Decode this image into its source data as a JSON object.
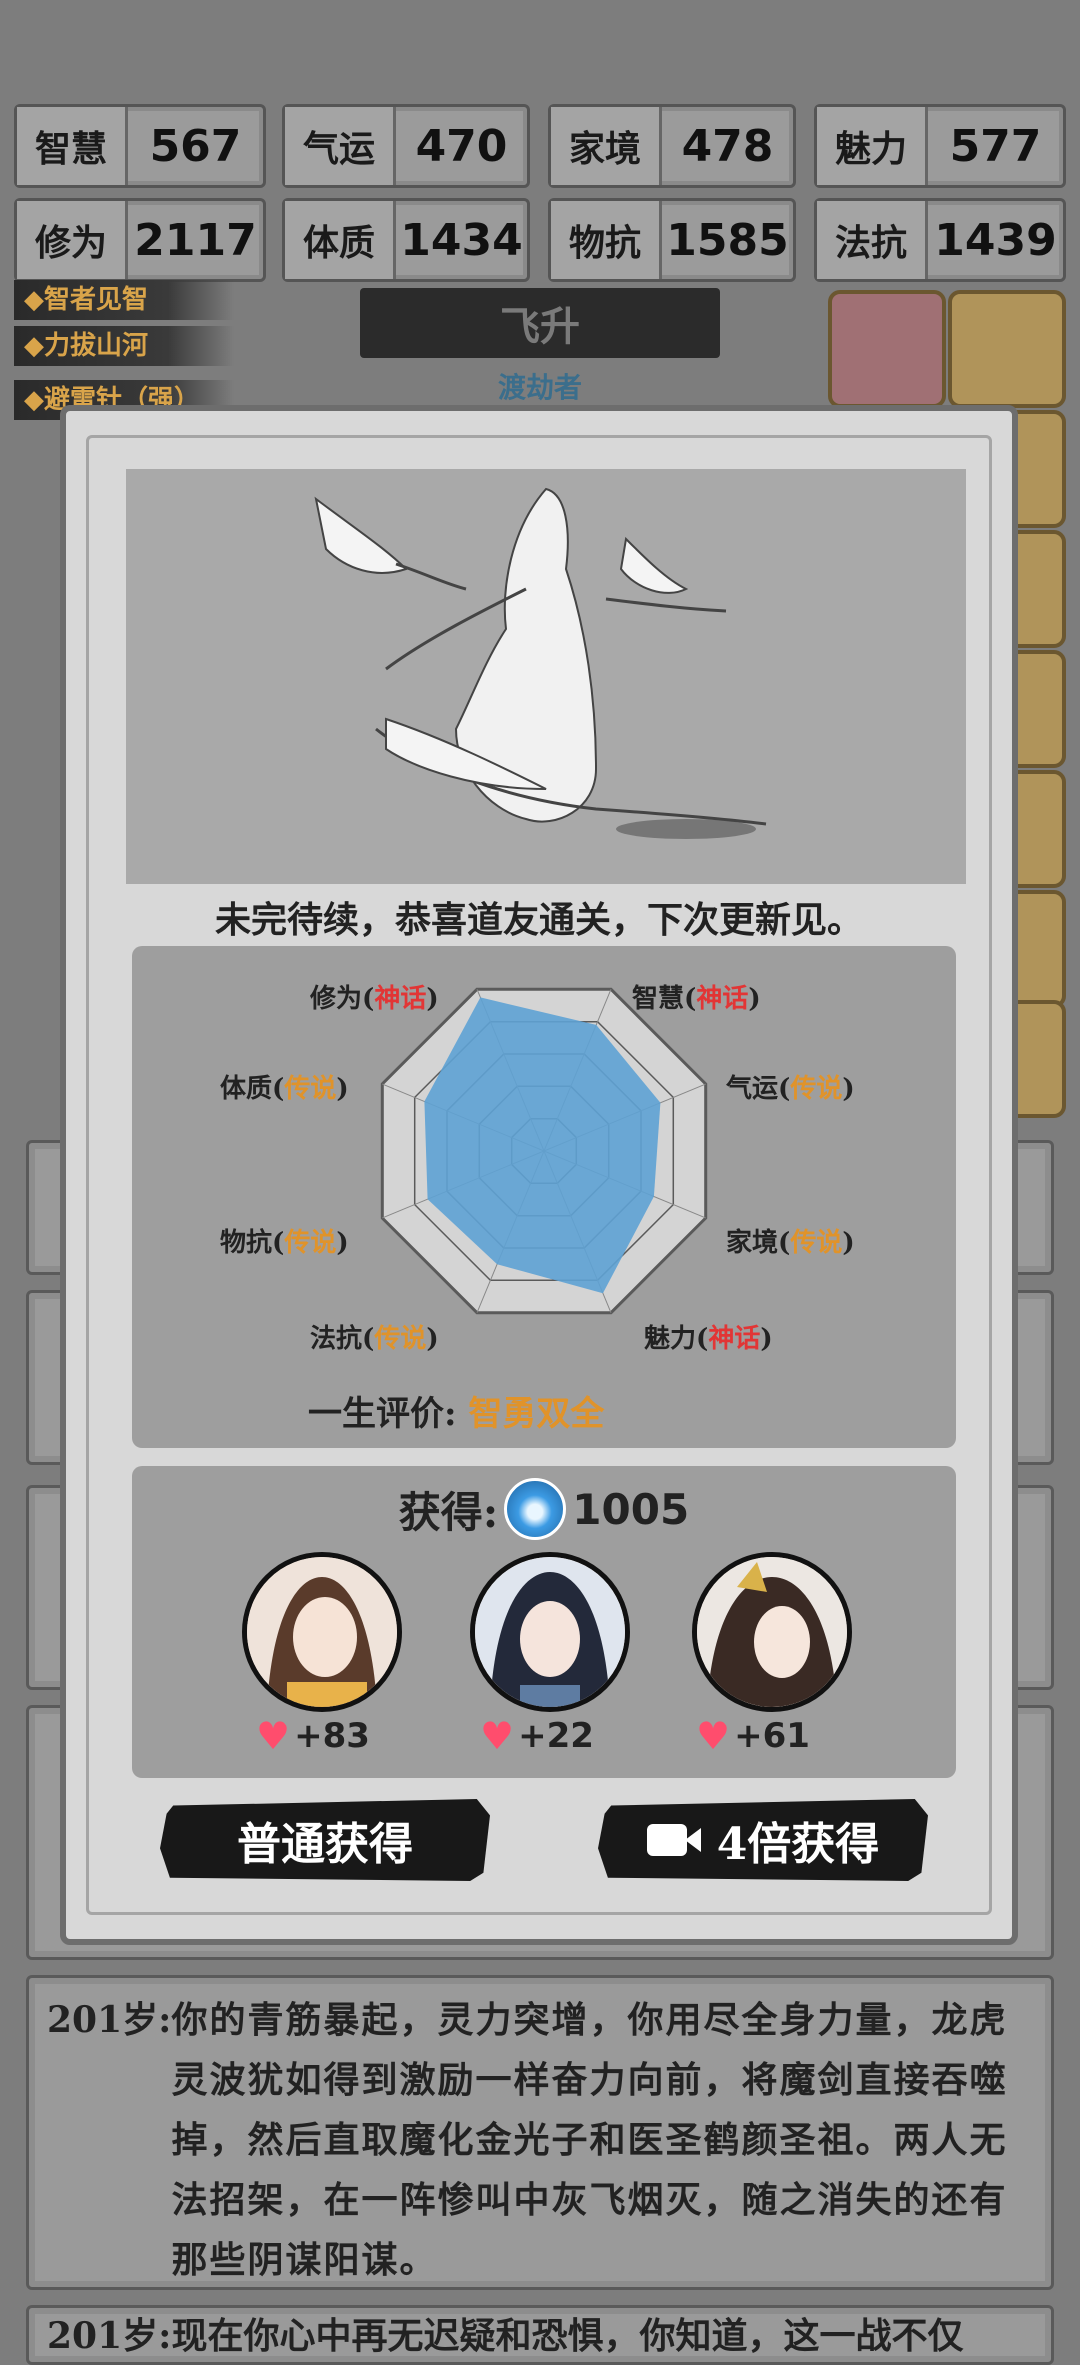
{
  "stats": [
    {
      "label": "智慧",
      "value": "567"
    },
    {
      "label": "气运",
      "value": "470"
    },
    {
      "label": "家境",
      "value": "478"
    },
    {
      "label": "魅力",
      "value": "577"
    },
    {
      "label": "修为",
      "value": "2117"
    },
    {
      "label": "体质",
      "value": "1434"
    },
    {
      "label": "物抗",
      "value": "1585"
    },
    {
      "label": "法抗",
      "value": "1439"
    }
  ],
  "side_tags": [
    "智者见智",
    "力拔山河",
    "避雷针（强）"
  ],
  "stage": {
    "title": "飞升",
    "subtitle": "渡劫者"
  },
  "modal": {
    "message": "未完待续，恭喜道友通关，下次更新见。",
    "radar": {
      "axes": [
        {
          "name": "修为",
          "tier": "神话"
        },
        {
          "name": "智慧",
          "tier": "神话"
        },
        {
          "name": "气运",
          "tier": "传说"
        },
        {
          "name": "家境",
          "tier": "传说"
        },
        {
          "name": "魅力",
          "tier": "神话"
        },
        {
          "name": "法抗",
          "tier": "传说"
        },
        {
          "name": "物抗",
          "tier": "传说"
        },
        {
          "name": "体质",
          "tier": "传说"
        }
      ],
      "values": [
        0.95,
        0.78,
        0.72,
        0.68,
        0.88,
        0.7,
        0.72,
        0.74
      ]
    },
    "evaluation_label": "一生评价:",
    "evaluation_value": "智勇双全",
    "reward_label": "获得:",
    "reward_amount": "1005",
    "companions": [
      {
        "name": "avatar-companion-1",
        "favor": "+83"
      },
      {
        "name": "avatar-companion-2",
        "favor": "+22"
      },
      {
        "name": "avatar-companion-3",
        "favor": "+61"
      }
    ],
    "btn_normal": "普通获得",
    "btn_4x": "4倍获得"
  },
  "logs": [
    {
      "age": "201岁:",
      "text": "你的青筋暴起，灵力突增，你用尽全身力量，龙虎灵波犹如得到激励一样奋力向前，将魔剑直接吞噬掉，然后直取魔化金光子和医圣鹤颜圣祖。两人无法招架，在一阵惨叫中灰飞烟灭，随之消失的还有那些阴谋阳谋。"
    },
    {
      "age": "201岁:",
      "text": "现在你心中再无迟疑和恐惧，你知道，这一战不仅"
    }
  ],
  "colors": {
    "myth": "#e23535",
    "legend": "#e0932a",
    "radar_fill": "#5ea2d4"
  }
}
